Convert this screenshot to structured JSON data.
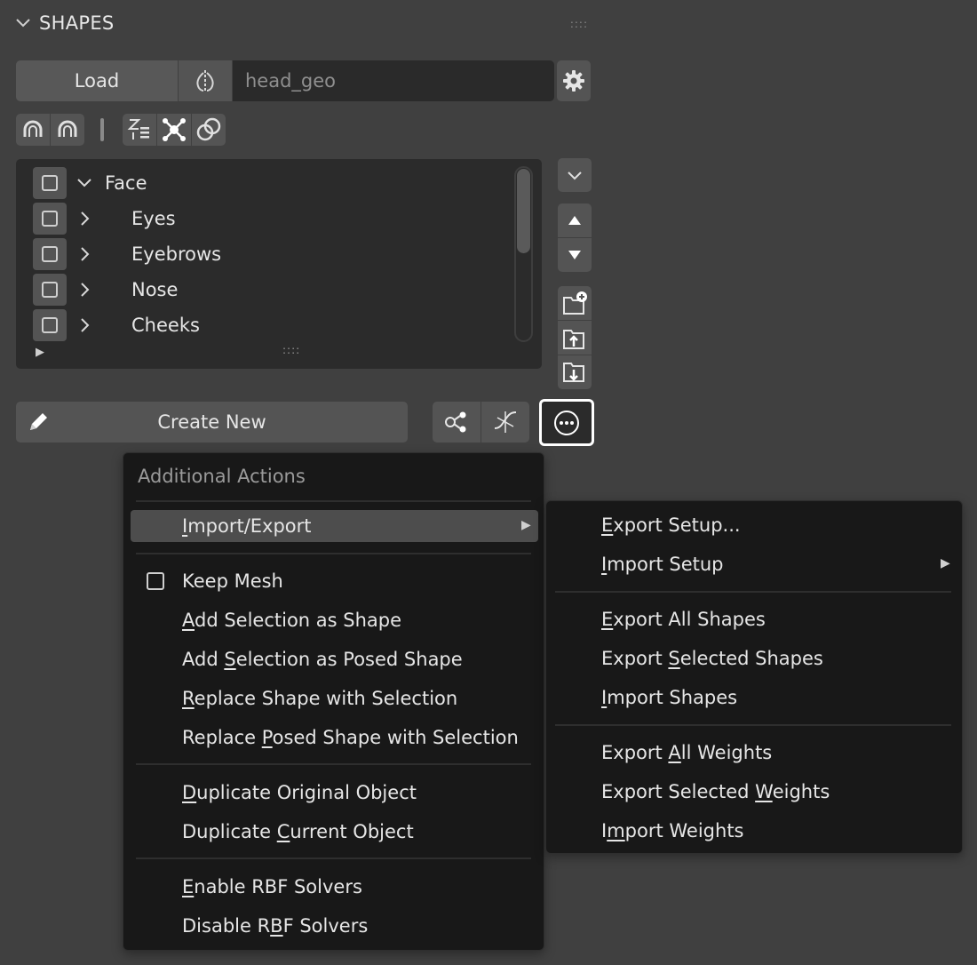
{
  "panel": {
    "title": "SHAPES"
  },
  "load_row": {
    "load_label": "Load",
    "name_value": "head_geo"
  },
  "tree": {
    "items": [
      {
        "label": "Face",
        "expanded": true
      },
      {
        "label": "Eyes",
        "expanded": false
      },
      {
        "label": "Eyebrows",
        "expanded": false
      },
      {
        "label": "Nose",
        "expanded": false
      },
      {
        "label": "Cheeks",
        "expanded": false
      }
    ]
  },
  "create_new_label": "Create New",
  "additional_actions": {
    "title": "Additional Actions",
    "import_export": {
      "pre": "",
      "u": "I",
      "post": "mport/Export"
    },
    "keep_mesh": "Keep Mesh",
    "add_selection_as_shape": {
      "pre": "",
      "u": "A",
      "post": "dd Selection as Shape"
    },
    "add_selection_as_posed_shape": {
      "pre": "Add ",
      "u": "S",
      "post": "election as Posed Shape"
    },
    "replace_shape_with_selection": {
      "pre": "",
      "u": "R",
      "post": "eplace Shape with Selection"
    },
    "replace_posed_shape_with_selection": {
      "pre": "Replace ",
      "u": "P",
      "post": "osed Shape with Selection"
    },
    "duplicate_original_object": {
      "pre": "",
      "u": "D",
      "post": "uplicate Original Object"
    },
    "duplicate_current_object": {
      "pre": "Duplicate ",
      "u": "C",
      "post": "urrent Object"
    },
    "enable_rbf_solvers": {
      "pre": "",
      "u": "E",
      "post": "nable RBF Solvers"
    },
    "disable_rbf_solvers": {
      "pre": "Disable R",
      "u": "B",
      "post": "F Solvers"
    }
  },
  "import_export_submenu": {
    "export_setup": {
      "pre": "",
      "u": "E",
      "post": "xport Setup..."
    },
    "import_setup": {
      "pre": "",
      "u": "I",
      "post": "mport Setup"
    },
    "export_all_shapes": {
      "pre": "",
      "u": "E",
      "post": "xport All Shapes"
    },
    "export_selected_shapes": {
      "pre": "Export ",
      "u": "S",
      "post": "elected Shapes"
    },
    "import_shapes": {
      "pre": "",
      "u": "I",
      "post": "mport Shapes"
    },
    "export_all_weights": {
      "pre": "Export ",
      "u": "A",
      "post": "ll Weights"
    },
    "export_selected_weights": {
      "pre": "Export Selected ",
      "u": "W",
      "post": "eights"
    },
    "import_weights": {
      "pre": "I",
      "u": "m",
      "post": "port Weights"
    }
  },
  "colors": {
    "background": "#404040",
    "button": "#545454",
    "field": "#2a2a2a",
    "menu": "#181818",
    "highlight": "#4d4d4d"
  }
}
